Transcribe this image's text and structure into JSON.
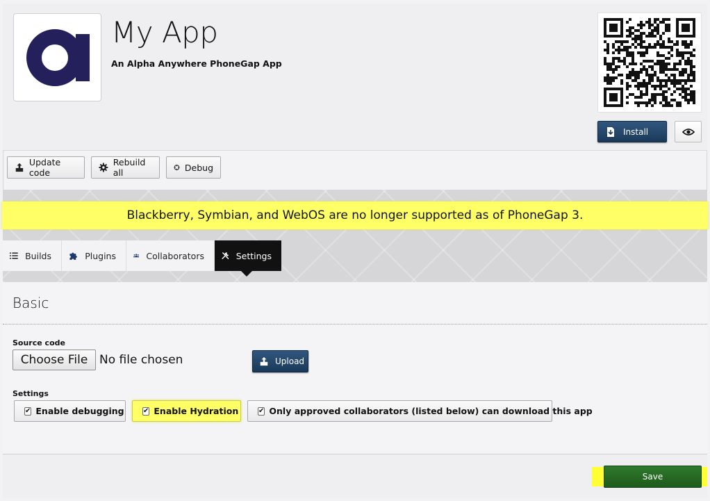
{
  "app": {
    "logo_letter": "a",
    "title": "My App",
    "subtitle": "An Alpha Anywhere PhoneGap App",
    "brand_color": "#23205c"
  },
  "install": {
    "label": "Install",
    "qr_icon": "qr-code-icon",
    "preview_icon": "eye-icon"
  },
  "toolbar": {
    "update_code": "Update code",
    "rebuild_all": "Rebuild all",
    "debug": "Debug"
  },
  "notice": {
    "text": "Blackberry, Symbian, and WebOS are no longer supported as of PhoneGap 3.",
    "highlight_color": "#ffff66"
  },
  "tabs": [
    {
      "label": "Builds",
      "icon": "list-icon",
      "active": false
    },
    {
      "label": "Plugins",
      "icon": "puzzle-icon",
      "active": false
    },
    {
      "label": "Collaborators",
      "icon": "users-icon",
      "active": false
    },
    {
      "label": "Settings",
      "icon": "tools-icon",
      "active": true
    }
  ],
  "basic": {
    "title": "Basic",
    "source_code_label": "Source code",
    "choose_file": "Choose File",
    "no_file": "No file chosen",
    "upload": "Upload",
    "settings_label": "Settings",
    "options": [
      {
        "label": "Enable debugging",
        "checked": true,
        "icon": "crosshair-icon"
      },
      {
        "label": "Enable Hydration",
        "checked": true,
        "icon": "drop-icon"
      },
      {
        "label": "Only approved collaborators (listed below) can download this app",
        "checked": true,
        "icon": "eye-icon"
      }
    ]
  },
  "footer": {
    "save": "Save",
    "save_color": "#2a6f28"
  }
}
